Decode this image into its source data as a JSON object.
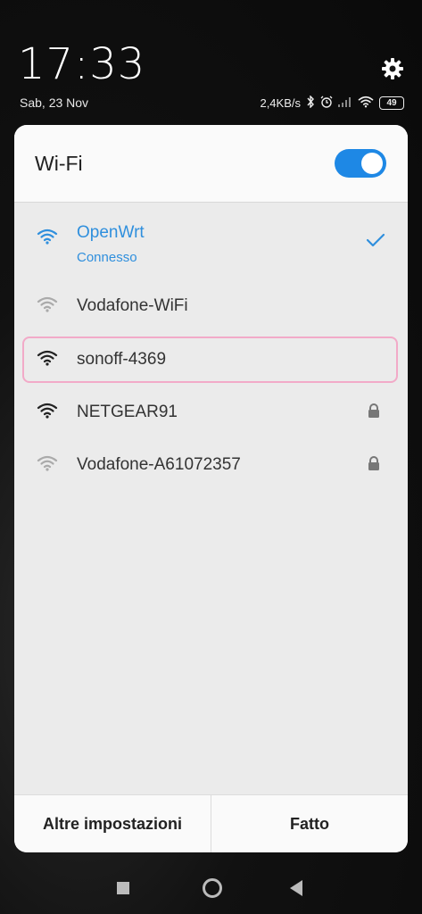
{
  "status": {
    "time": "17:33",
    "date": "Sab, 23 Nov",
    "network_speed": "2,4KB/s",
    "battery": "49"
  },
  "wifi_panel": {
    "title": "Wi-Fi",
    "enabled": true,
    "accent_color": "#1e88e5",
    "networks": [
      {
        "name": "OpenWrt",
        "status": "Connesso",
        "connected": true
      },
      {
        "name": "Vodafone-WiFi",
        "locked": false
      },
      {
        "name": "sonoff-4369",
        "locked": false,
        "highlighted": true
      },
      {
        "name": "NETGEAR91",
        "locked": true
      },
      {
        "name": "Vodafone-A61072357",
        "locked": true
      }
    ],
    "more_settings_label": "Altre impostazioni",
    "done_label": "Fatto"
  },
  "icons": [
    "gear-icon",
    "bluetooth-icon",
    "alarm-icon",
    "signal-icon",
    "wifi-icon",
    "lock-icon",
    "check-icon"
  ]
}
